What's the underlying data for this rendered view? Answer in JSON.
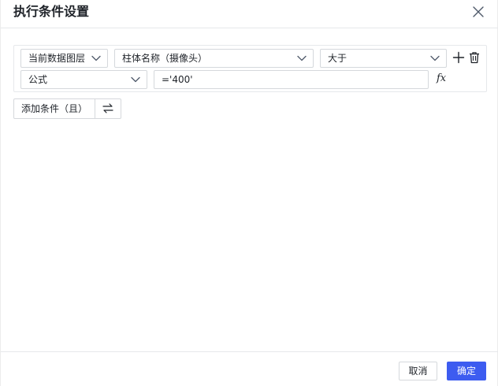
{
  "dialog": {
    "title": "执行条件设置"
  },
  "condition": {
    "layer_select": "当前数据图层",
    "field_select": "柱体名称（摄像头）",
    "operator_select": "大于",
    "value_type_select": "公式",
    "value_input": "='400'",
    "fx_label": "fx"
  },
  "actions": {
    "add_condition_label": "添加条件（且）"
  },
  "footer": {
    "cancel_label": "取消",
    "ok_label": "确定"
  },
  "colors": {
    "primary": "#3d5cf0",
    "border": "#d5d8dc",
    "text": "#1f2329"
  },
  "icons": [
    "close-icon",
    "chevron-down-icon",
    "plus-icon",
    "trash-icon",
    "fx-icon",
    "swap-icon"
  ]
}
